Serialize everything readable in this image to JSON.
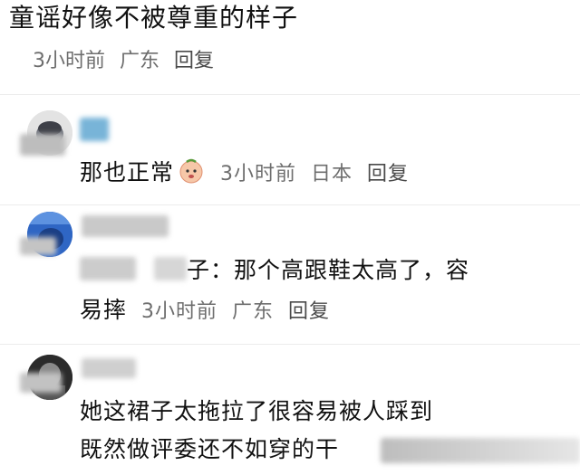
{
  "top_comment": {
    "text": "童谣好像不被尊重的样子",
    "time": "3小时前",
    "location": "广东",
    "reply": "回复"
  },
  "replies": [
    {
      "text": "那也正常",
      "has_emoji": true,
      "time": "3小时前",
      "location": "日本",
      "reply": "回复"
    },
    {
      "quoted_prefix": "子：",
      "line1": "那个高跟鞋太高了，容",
      "line2": "易摔",
      "time": "3小时前",
      "location": "广东",
      "reply": "回复"
    },
    {
      "line1": "她这裙子太拖拉了很容易被人踩到",
      "line2": "既然做评委还不如穿的干"
    }
  ],
  "colors": {
    "meta": "#6e6e6e",
    "text": "#111111",
    "blur_gray": "#c8c8c8",
    "blur_blue": "#3a7bd5"
  }
}
